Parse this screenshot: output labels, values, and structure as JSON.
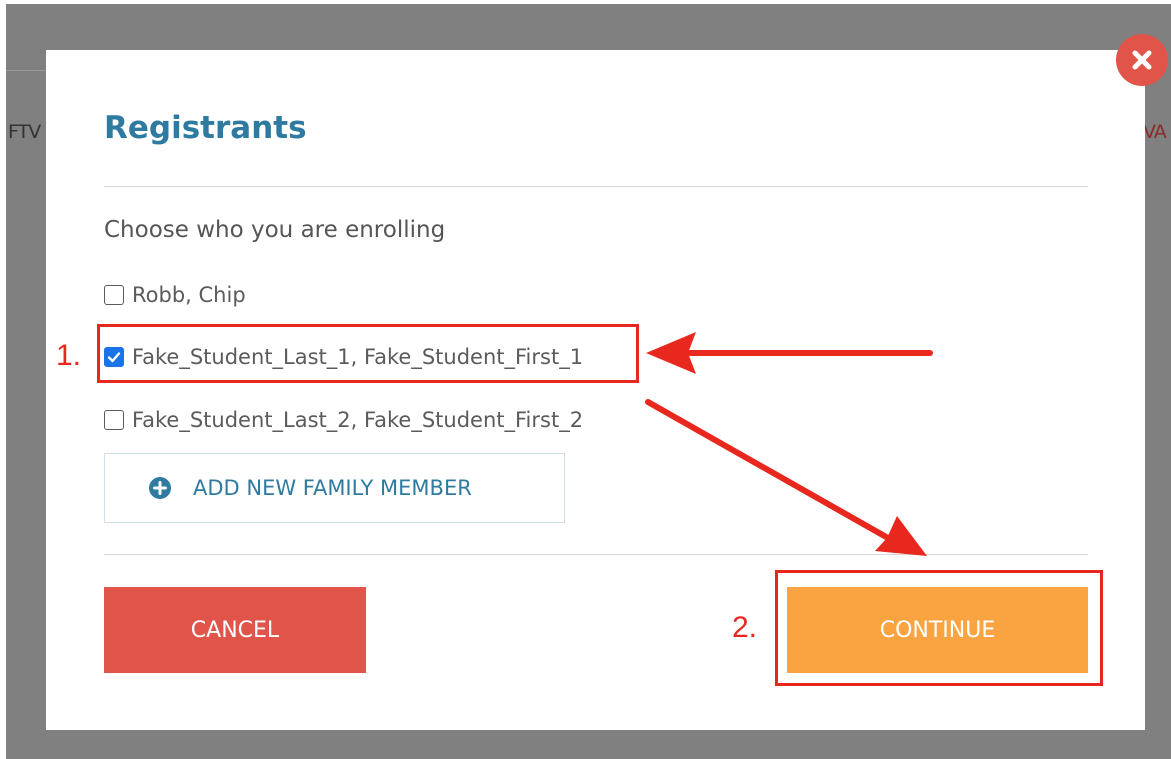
{
  "background": {
    "left_text": "FTV",
    "right_text": "VA"
  },
  "modal": {
    "title": "Registrants",
    "prompt": "Choose who you are enrolling",
    "registrants": [
      {
        "label": "Robb, Chip",
        "checked": false
      },
      {
        "label": "Fake_Student_Last_1, Fake_Student_First_1",
        "checked": true
      },
      {
        "label": "Fake_Student_Last_2, Fake_Student_First_2",
        "checked": false
      }
    ],
    "add_member_label": "ADD NEW FAMILY MEMBER",
    "cancel_label": "CANCEL",
    "continue_label": "CONTINUE"
  },
  "annotations": {
    "step_1": "1.",
    "step_2": "2."
  },
  "colors": {
    "title": "#2f7aa1",
    "cancel": "#e0544a",
    "continue": "#f9a441",
    "annotation": "#e8281e",
    "checkbox_checked": "#1a73e8"
  },
  "icons": {
    "close": "close-icon",
    "add": "plus-circle-icon",
    "check": "checkmark-icon",
    "arrow": "arrow-icon"
  }
}
